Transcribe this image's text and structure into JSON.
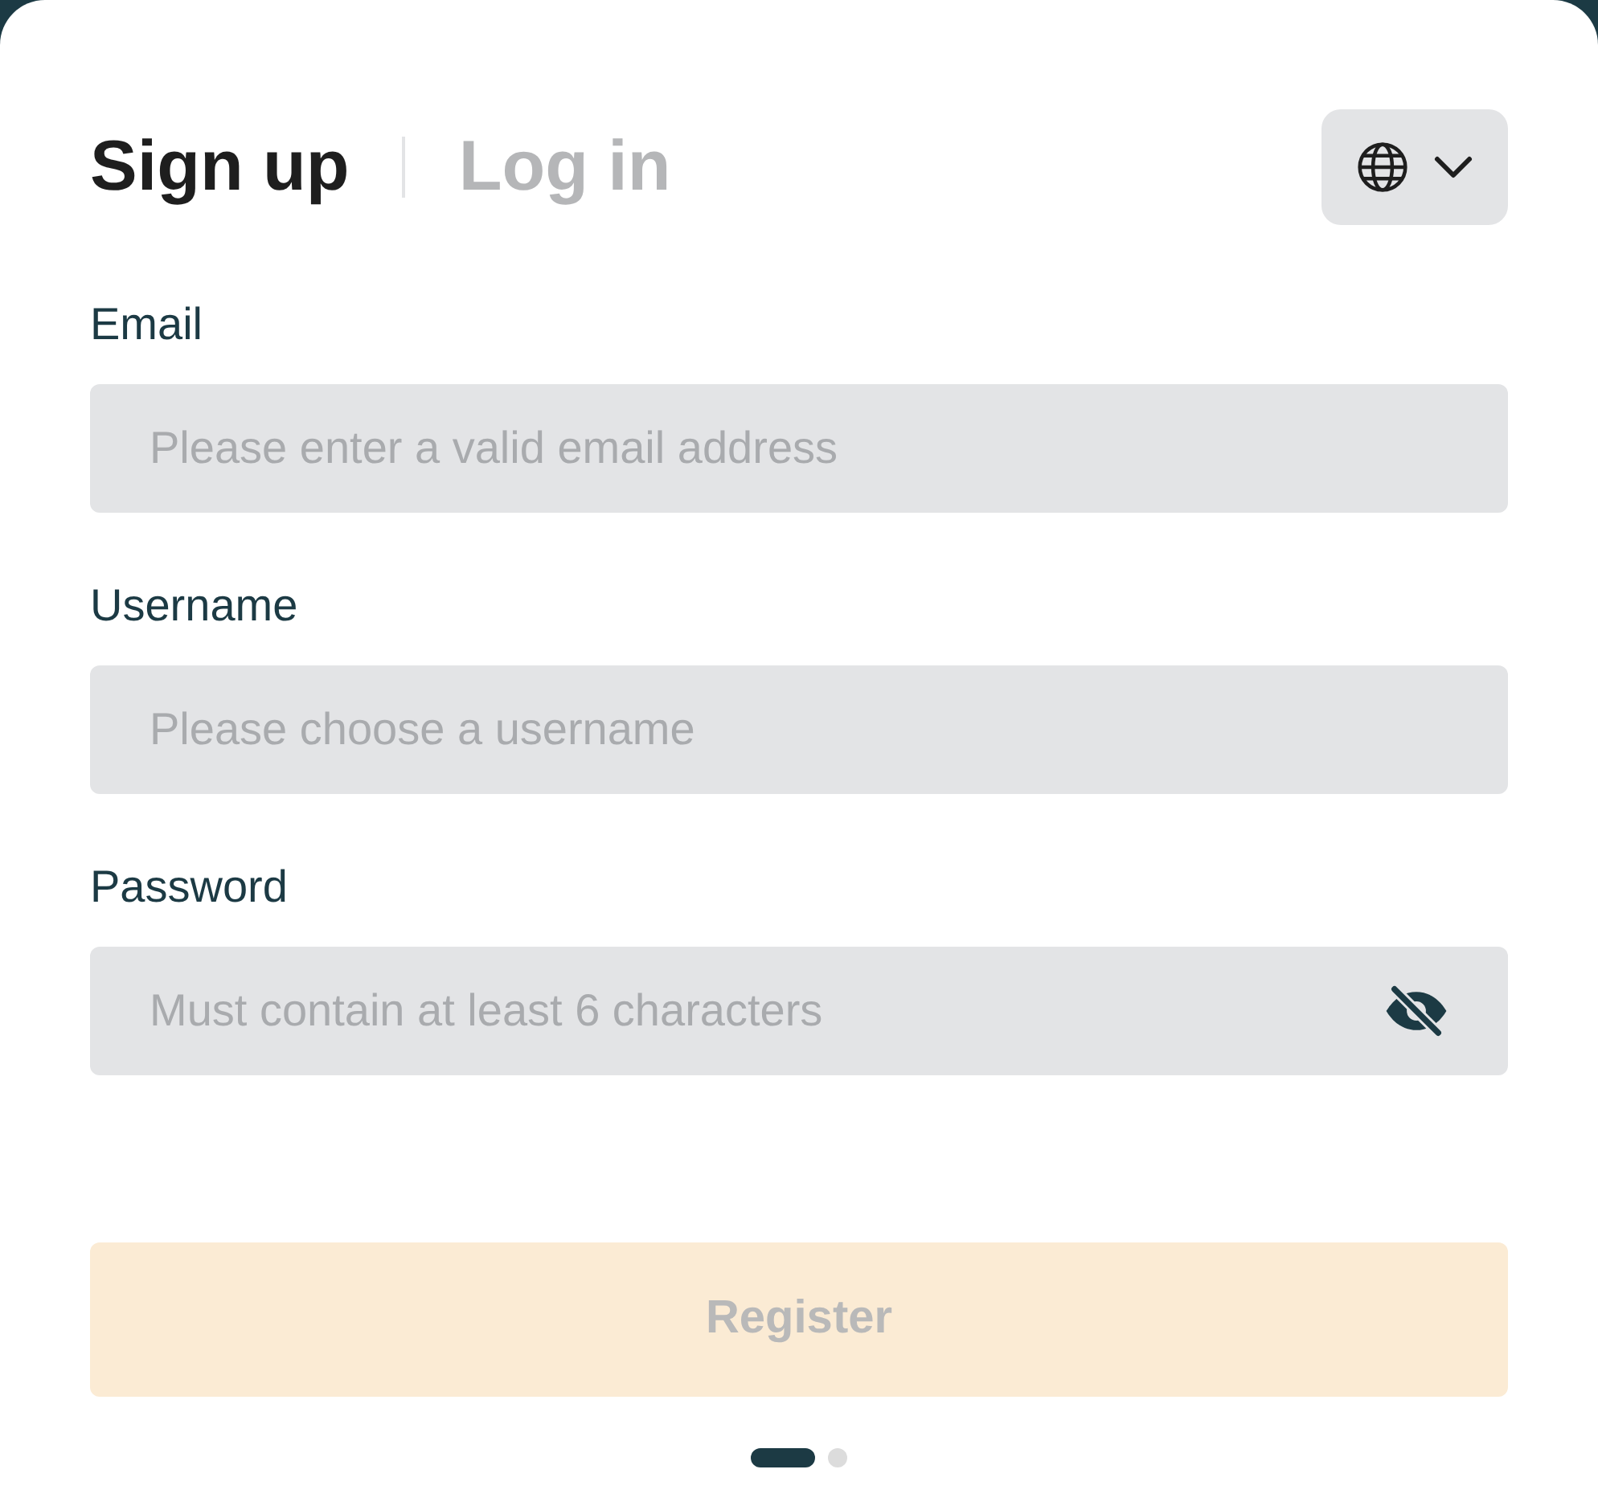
{
  "tabs": [
    {
      "label": "Sign up",
      "selected": true
    },
    {
      "label": "Log in",
      "selected": false
    }
  ],
  "language_menu": {
    "expanded": false
  },
  "fields": [
    {
      "label": "Email",
      "placeholder": "Please enter a valid email address",
      "kind": "text"
    },
    {
      "label": "Username",
      "placeholder": "Please choose a username",
      "kind": "text"
    },
    {
      "label": "Password",
      "placeholder": "Must contain at least 6 characters",
      "kind": "password",
      "visible": false
    }
  ],
  "register_button": {
    "label": "Register",
    "disabled": true
  },
  "pager": [
    {
      "selected": true
    },
    {
      "selected": false
    }
  ]
}
